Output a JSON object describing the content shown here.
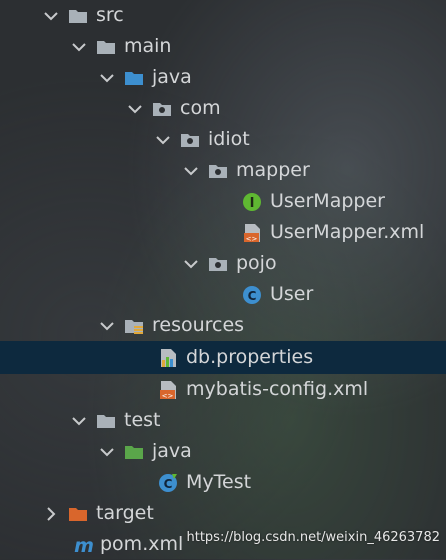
{
  "tree": {
    "items": [
      {
        "label": "src",
        "icon": "folder-icon",
        "expanded": true
      },
      {
        "label": "main",
        "icon": "folder-icon",
        "expanded": true
      },
      {
        "label": "java",
        "icon": "source-root-folder-icon",
        "expanded": true
      },
      {
        "label": "com",
        "icon": "package-icon",
        "expanded": true
      },
      {
        "label": "idiot",
        "icon": "package-icon",
        "expanded": true
      },
      {
        "label": "mapper",
        "icon": "package-icon",
        "expanded": true
      },
      {
        "label": "UserMapper",
        "icon": "interface-icon"
      },
      {
        "label": "UserMapper.xml",
        "icon": "xml-file-icon"
      },
      {
        "label": "pojo",
        "icon": "package-icon",
        "expanded": true
      },
      {
        "label": "User",
        "icon": "class-icon"
      },
      {
        "label": "resources",
        "icon": "resources-folder-icon",
        "expanded": true
      },
      {
        "label": "db.properties",
        "icon": "properties-file-icon",
        "selected": true
      },
      {
        "label": "mybatis-config.xml",
        "icon": "xml-file-icon"
      },
      {
        "label": "test",
        "icon": "folder-icon",
        "expanded": true
      },
      {
        "label": "java",
        "icon": "test-source-folder-icon",
        "expanded": true
      },
      {
        "label": "MyTest",
        "icon": "class-icon"
      },
      {
        "label": "target",
        "icon": "excluded-folder-icon",
        "expanded": false
      },
      {
        "label": "pom.xml",
        "icon": "maven-file-icon"
      }
    ]
  },
  "watermark": "https://blog.csdn.net/weixin_46263782",
  "colors": {
    "selection": "#0d293e",
    "text": "#d4d6d8",
    "folder": "#a9b1b8",
    "source_root": "#3d8fcf",
    "test_root": "#5aa64a",
    "excluded": "#d9662c",
    "interface": "#5fb832",
    "class": "#3d8fcf"
  }
}
